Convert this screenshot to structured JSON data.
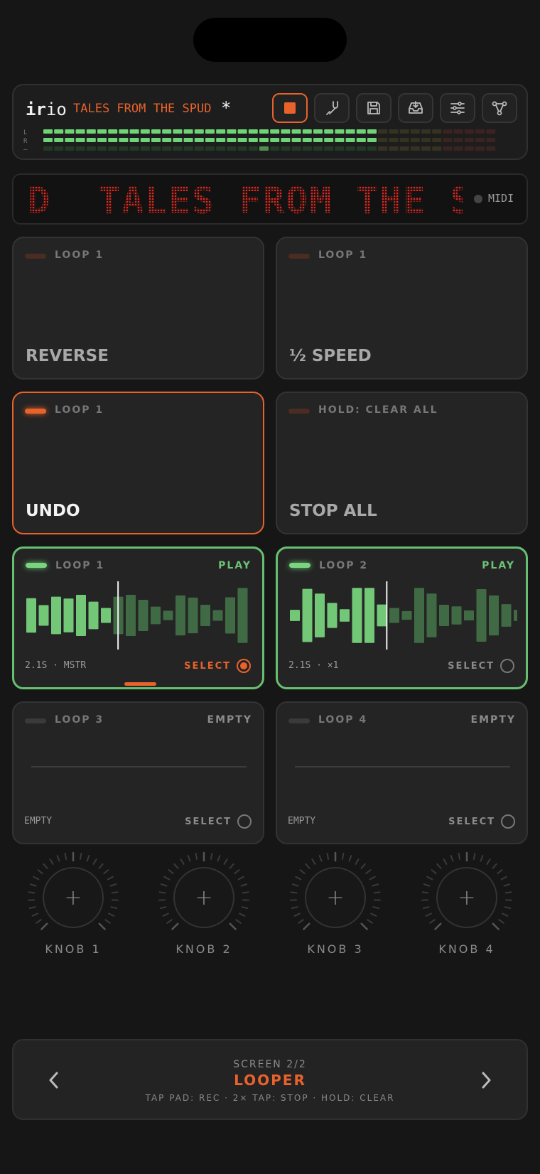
{
  "header": {
    "brand_bold": "ir",
    "brand_light": "io",
    "project_name": "TALES FROM THE SPUD",
    "unsaved_marker": "*",
    "toolbar": [
      {
        "name": "stop-icon"
      },
      {
        "name": "tuning-fork-icon"
      },
      {
        "name": "save-icon"
      },
      {
        "name": "inbox-download-icon"
      },
      {
        "name": "sliders-icon"
      },
      {
        "name": "routing-icon"
      }
    ],
    "meter_labels": [
      "L",
      "R",
      "—"
    ],
    "meters": {
      "left_level": 0.73,
      "right_level": 0.73,
      "third_peak": 0.48
    }
  },
  "marquee": {
    "text": "D  TALES FROM THE S",
    "midi_label": "MIDI"
  },
  "pads": [
    {
      "tag": "LOOP 1",
      "title": "REVERSE"
    },
    {
      "tag": "LOOP 1",
      "title": "½ SPEED"
    },
    {
      "tag": "LOOP 1",
      "title": "UNDO"
    },
    {
      "tag": "HOLD: CLEAR ALL",
      "title": "STOP ALL"
    }
  ],
  "loops": [
    {
      "name": "LOOP 1",
      "state": "PLAY",
      "info": "2.1S · MSTR",
      "select": "SELECT",
      "selected": true,
      "playhead": 0.41,
      "bars": [
        0.55,
        0.33,
        0.6,
        0.54,
        0.66,
        0.44,
        0.24,
        0.6,
        0.66,
        0.5,
        0.28,
        0.15,
        0.64,
        0.57,
        0.34,
        0.17,
        0.58,
        0.88
      ]
    },
    {
      "name": "LOOP 2",
      "state": "PLAY",
      "info": "2.1S · ×1",
      "select": "SELECT",
      "selected": false,
      "playhead": 0.41,
      "bars": [
        0.18,
        0.85,
        0.7,
        0.4,
        0.2,
        0.88,
        0.88,
        0.35,
        0.24,
        0.14,
        0.88,
        0.7,
        0.34,
        0.29,
        0.16,
        0.84,
        0.64,
        0.36,
        0.18
      ]
    },
    {
      "name": "LOOP 3",
      "state": "EMPTY",
      "info": "EMPTY",
      "select": "SELECT",
      "selected": false
    },
    {
      "name": "LOOP 4",
      "state": "EMPTY",
      "info": "EMPTY",
      "select": "SELECT",
      "selected": false
    }
  ],
  "knobs": [
    {
      "label": "KNOB 1",
      "symbol": "+"
    },
    {
      "label": "KNOB 2",
      "symbol": "+"
    },
    {
      "label": "KNOB 3",
      "symbol": "+"
    },
    {
      "label": "KNOB 4",
      "symbol": "+"
    }
  ],
  "footer": {
    "screen": "SCREEN 2/2",
    "mode": "LOOPER",
    "hint": "TAP PAD: REC · 2× TAP: STOP · HOLD: CLEAR",
    "prev_icon": "chevron-left-icon",
    "next_icon": "chevron-right-icon"
  },
  "colors": {
    "accent": "#e8622c",
    "play": "#6cc274",
    "led_text": "#e0291f"
  }
}
